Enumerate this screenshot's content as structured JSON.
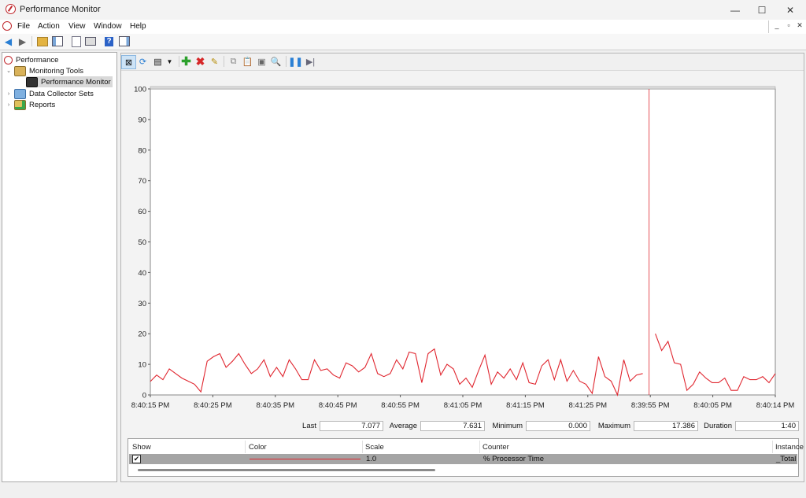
{
  "window": {
    "title": "Performance Monitor",
    "min_glyph": "—",
    "max_glyph": "☐",
    "close_glyph": "✕"
  },
  "menu": [
    "File",
    "Action",
    "View",
    "Window",
    "Help"
  ],
  "mdi_controls": [
    "_",
    "▫",
    "✕"
  ],
  "tree": {
    "root": "Performance",
    "monitoring_tools": "Monitoring Tools",
    "performance_monitor": "Performance Monitor",
    "data_collector_sets": "Data Collector Sets",
    "reports": "Reports"
  },
  "stats": {
    "last_label": "Last",
    "last_value": "7.077",
    "average_label": "Average",
    "average_value": "7.631",
    "minimum_label": "Minimum",
    "minimum_value": "0.000",
    "maximum_label": "Maximum",
    "maximum_value": "17.386",
    "duration_label": "Duration",
    "duration_value": "1:40"
  },
  "legend": {
    "headers": [
      "Show",
      "Color",
      "Scale",
      "Counter",
      "Instance"
    ],
    "row": {
      "show": true,
      "color": "#e0262f",
      "scale": "1.0",
      "counter": "% Processor Time",
      "instance": "_Total"
    }
  },
  "chart_data": {
    "type": "line",
    "ylim": [
      0,
      100
    ],
    "yticks": [
      0,
      10,
      20,
      30,
      40,
      50,
      60,
      70,
      80,
      90,
      100
    ],
    "x_tick_labels": [
      "8:40:15 PM",
      "8:40:25 PM",
      "8:40:35 PM",
      "8:40:45 PM",
      "8:40:55 PM",
      "8:41:05 PM",
      "8:41:15 PM",
      "8:41:25 PM",
      "8:39:55 PM",
      "8:40:05 PM",
      "8:40:14 PM"
    ],
    "current_position_index": 79,
    "color": "#e0262f",
    "values": [
      4.4,
      6.5,
      5.0,
      8.5,
      7.0,
      5.5,
      4.5,
      3.5,
      1.0,
      11.0,
      12.5,
      13.5,
      9.0,
      11.0,
      13.5,
      10.0,
      7.0,
      8.5,
      11.5,
      6.0,
      9.0,
      6.0,
      11.5,
      8.5,
      5.0,
      5.0,
      11.5,
      8.0,
      8.5,
      6.5,
      5.5,
      10.5,
      9.5,
      7.5,
      9.0,
      13.5,
      7.0,
      6.0,
      7.0,
      11.5,
      8.5,
      14.0,
      13.5,
      4.0,
      13.5,
      15.0,
      6.5,
      10.0,
      8.5,
      3.5,
      5.5,
      2.5,
      8.0,
      13.0,
      3.5,
      7.5,
      5.5,
      8.5,
      5.0,
      10.5,
      4.0,
      3.5,
      9.5,
      11.5,
      5.0,
      11.5,
      4.5,
      8.0,
      4.5,
      3.5,
      0.5,
      12.5,
      6.0,
      4.5,
      0.0,
      11.5,
      4.5,
      6.5,
      7.0,
      null,
      20.0,
      14.5,
      17.5,
      10.5,
      10.0,
      1.5,
      3.5,
      7.5,
      5.5,
      4.0,
      4.0,
      5.5,
      1.5,
      1.5,
      6.0,
      5.0,
      5.0,
      6.0,
      4.0,
      7.0
    ]
  }
}
